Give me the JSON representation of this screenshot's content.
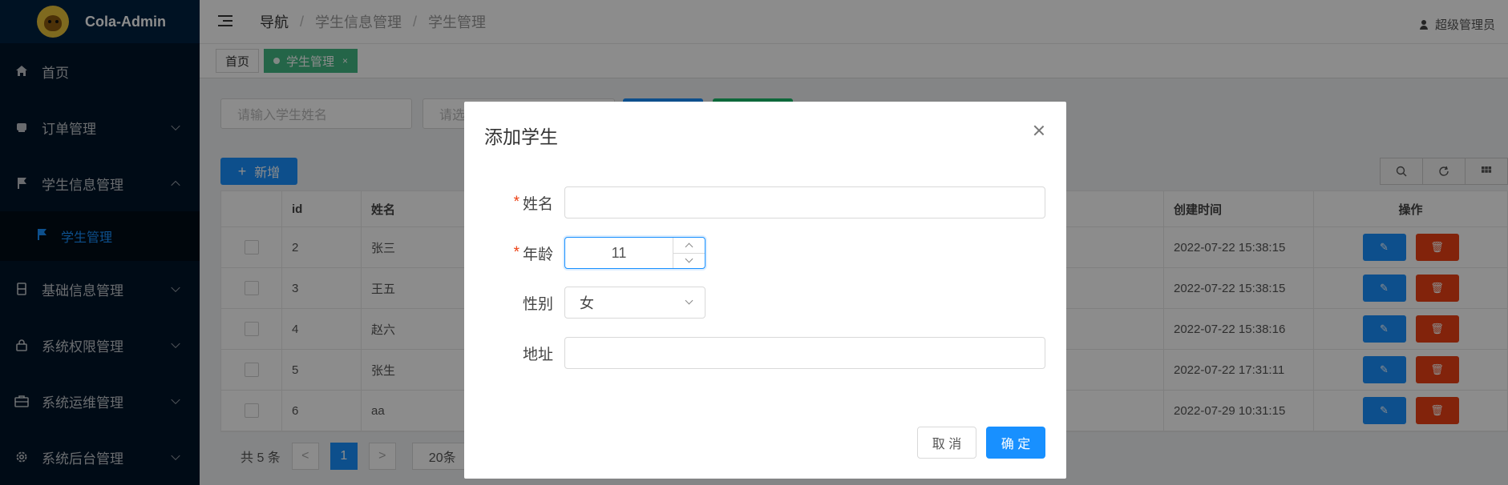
{
  "app": {
    "logo_text": "Cola-Admin"
  },
  "sidebar": {
    "items": [
      {
        "label": "首页",
        "icon": "home-icon"
      },
      {
        "label": "订单管理",
        "icon": "order-icon"
      },
      {
        "label": "学生信息管理",
        "icon": "flag-icon"
      },
      {
        "label": "学生管理",
        "icon": "flag-icon"
      },
      {
        "label": "基础信息管理",
        "icon": "document-icon"
      },
      {
        "label": "系统权限管理",
        "icon": "lock-icon"
      },
      {
        "label": "系统运维管理",
        "icon": "toolbox-icon"
      },
      {
        "label": "系统后台管理",
        "icon": "gear-icon"
      }
    ]
  },
  "header": {
    "breadcrumb": [
      "导航",
      "学生信息管理",
      "学生管理"
    ],
    "separator": "/",
    "user": "超级管理员"
  },
  "tabs": [
    {
      "label": "首页",
      "active": false
    },
    {
      "label": "学生管理",
      "active": true,
      "close": "×"
    }
  ],
  "toolbar": {
    "search_placeholder": "请输入学生姓名",
    "select_placeholder": "请选",
    "add_label": "新增",
    "add_symbol": "+"
  },
  "table": {
    "columns": {
      "id": "id",
      "name": "姓名",
      "time": "创建时间",
      "ops": "操作"
    },
    "rows": [
      {
        "id": "2",
        "name": "张三",
        "time": "2022-07-22 15:38:15"
      },
      {
        "id": "3",
        "name": "王五",
        "time": "2022-07-22 15:38:15"
      },
      {
        "id": "4",
        "name": "赵六",
        "time": "2022-07-22 15:38:16"
      },
      {
        "id": "5",
        "name": "张生",
        "time": "2022-07-22 17:31:11"
      },
      {
        "id": "6",
        "name": "aa",
        "time": "2022-07-29 10:31:15"
      }
    ]
  },
  "pager": {
    "total": "共 5 条",
    "prev": "<",
    "page": "1",
    "next": ">",
    "size": "20条"
  },
  "modal": {
    "title": "添加学生",
    "fields": {
      "name_label": "姓名",
      "name_value": "",
      "age_label": "年龄",
      "age_value": "11",
      "gender_label": "性别",
      "gender_value": "女",
      "address_label": "地址",
      "address_value": ""
    },
    "required_mark": "*",
    "cancel": "取 消",
    "ok": "确 定"
  },
  "colors": {
    "sidebar_bg": "#001529",
    "primary": "#1890ff",
    "success": "#19be6b",
    "danger": "#ed4014",
    "tab_active": "#42b983"
  }
}
